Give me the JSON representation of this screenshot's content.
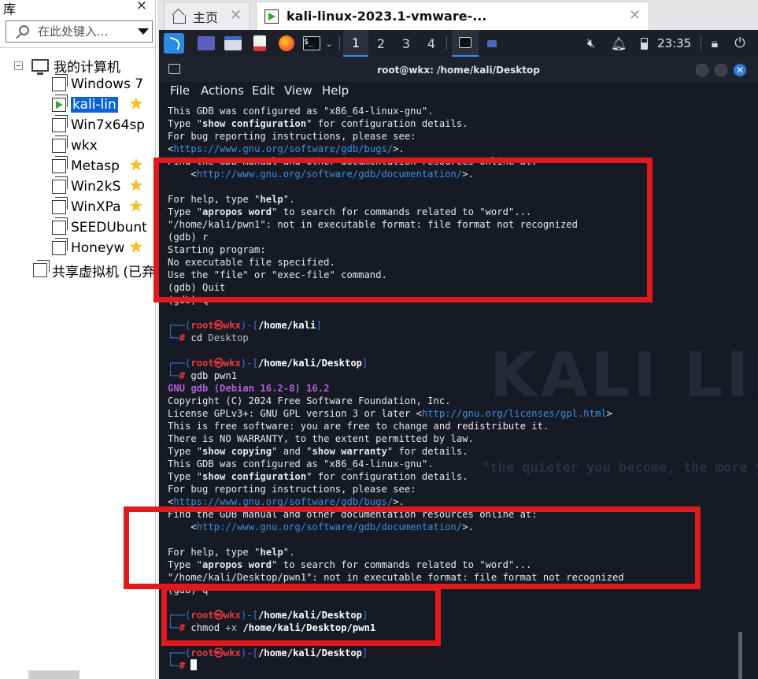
{
  "library": {
    "title": "库",
    "close": "×",
    "search_placeholder": "在此处键入...",
    "root": "我的计算机",
    "items": [
      {
        "label": "Windows 7",
        "starred": false,
        "running": false,
        "selected": false
      },
      {
        "label": "kali-lin",
        "starred": true,
        "running": true,
        "selected": true
      },
      {
        "label": "Win7x64sp",
        "starred": false,
        "running": false,
        "selected": false
      },
      {
        "label": "wkx",
        "starred": false,
        "running": false,
        "selected": false
      },
      {
        "label": "Metasp",
        "starred": true,
        "running": false,
        "selected": false
      },
      {
        "label": "Win2kS",
        "starred": true,
        "running": false,
        "selected": false
      },
      {
        "label": "WinXPa",
        "starred": true,
        "running": false,
        "selected": false
      },
      {
        "label": "SEEDUbunt",
        "starred": false,
        "running": false,
        "selected": false
      },
      {
        "label": "Honeyw",
        "starred": true,
        "running": false,
        "selected": false
      }
    ],
    "shared": "共享虚拟机 (已弃"
  },
  "tabs": {
    "home": "主页",
    "vm": "kali-linux-2023.1-vmware-..."
  },
  "kali_panel": {
    "workspaces": [
      "1",
      "2",
      "3",
      "4"
    ],
    "active_workspace": "1",
    "clock": "23:35"
  },
  "terminal": {
    "title": "root@wkx: /home/kali/Desktop",
    "menu": [
      "File",
      "Actions",
      "Edit",
      "View",
      "Help"
    ],
    "watermark_logo": "KALI LINUX",
    "watermark_slogan": "\"the quieter you become, the more you are able to hear\"",
    "lines": [
      [
        {
          "t": "This GDB was configured as \"x86_64-linux-gnu\"."
        }
      ],
      [
        {
          "t": "Type \""
        },
        {
          "t": "show configuration",
          "c": "b"
        },
        {
          "t": "\" for configuration details."
        }
      ],
      [
        {
          "t": "For bug reporting instructions, please see:"
        }
      ],
      [
        {
          "t": "<"
        },
        {
          "t": "https://www.gnu.org/software/gdb/bugs/",
          "c": "cyan"
        },
        {
          "t": ">."
        }
      ],
      [
        {
          "t": "Find the GDB manual and other documentation resources online at:"
        }
      ],
      [
        {
          "t": "    <"
        },
        {
          "t": "http://www.gnu.org/software/gdb/documentation/",
          "c": "cyan"
        },
        {
          "t": ">."
        }
      ],
      [],
      [
        {
          "t": "For help, type \""
        },
        {
          "t": "help",
          "c": "b"
        },
        {
          "t": "\"."
        }
      ],
      [
        {
          "t": "Type \""
        },
        {
          "t": "apropos word",
          "c": "b"
        },
        {
          "t": "\" to search for commands related to \"word\"..."
        }
      ],
      [
        {
          "t": "\"/home/kali/pwn1\": not in executable format: file format not recognized"
        }
      ],
      [
        {
          "t": "(gdb) r"
        }
      ],
      [
        {
          "t": "Starting program:"
        }
      ],
      [
        {
          "t": "No executable file specified."
        }
      ],
      [
        {
          "t": "Use the \"file\" or \"exec-file\" command."
        }
      ],
      [
        {
          "t": "(gdb) Quit"
        }
      ],
      [
        {
          "t": "(gdb) q"
        }
      ],
      [],
      [
        {
          "t": "┌──(",
          "c": "blue"
        },
        {
          "t": "root㉿wkx",
          "c": "red"
        },
        {
          "t": ")-[",
          "c": "blue"
        },
        {
          "t": "/home/kali",
          "c": "path"
        },
        {
          "t": "]",
          "c": "blue"
        }
      ],
      [
        {
          "t": "└─",
          "c": "blue"
        },
        {
          "t": "#",
          "c": "red"
        },
        {
          "t": " cd "
        },
        {
          "t": "Desktop",
          "c": "gray"
        }
      ],
      [],
      [
        {
          "t": "┌──(",
          "c": "blue"
        },
        {
          "t": "root㉿wkx",
          "c": "red"
        },
        {
          "t": ")-[",
          "c": "blue"
        },
        {
          "t": "/home/kali/Desktop",
          "c": "path"
        },
        {
          "t": "]",
          "c": "blue"
        }
      ],
      [
        {
          "t": "└─",
          "c": "blue"
        },
        {
          "t": "#",
          "c": "red"
        },
        {
          "t": " gdb "
        },
        {
          "t": "pwn1"
        }
      ],
      [
        {
          "t": "GNU gdb (Debian 16.2-8) 16.2",
          "c": "purple"
        }
      ],
      [
        {
          "t": "Copyright (C) 2024 Free Software Foundation, Inc."
        }
      ],
      [
        {
          "t": "License GPLv3+: GNU GPL version 3 or later <"
        },
        {
          "t": "http://gnu.org/licenses/gpl.html",
          "c": "cyan"
        },
        {
          "t": ">"
        }
      ],
      [
        {
          "t": "This is free software: you are free to change and redistribute it."
        }
      ],
      [
        {
          "t": "There is NO WARRANTY, to the extent permitted by law."
        }
      ],
      [
        {
          "t": "Type \""
        },
        {
          "t": "show copying",
          "c": "b"
        },
        {
          "t": "\" and \""
        },
        {
          "t": "show warranty",
          "c": "b"
        },
        {
          "t": "\" for details."
        }
      ],
      [
        {
          "t": "This GDB was configured as \"x86_64-linux-gnu\"."
        }
      ],
      [
        {
          "t": "Type \""
        },
        {
          "t": "show configuration",
          "c": "b"
        },
        {
          "t": "\" for configuration details."
        }
      ],
      [
        {
          "t": "For bug reporting instructions, please see:"
        }
      ],
      [
        {
          "t": "<"
        },
        {
          "t": "https://www.gnu.org/software/gdb/bugs/",
          "c": "cyan"
        },
        {
          "t": ">."
        }
      ],
      [
        {
          "t": "Find the GDB manual and other documentation resources online at:"
        }
      ],
      [
        {
          "t": "    <"
        },
        {
          "t": "http://www.gnu.org/software/gdb/documentation/",
          "c": "cyan"
        },
        {
          "t": ">."
        }
      ],
      [],
      [
        {
          "t": "For help, type \""
        },
        {
          "t": "help",
          "c": "b"
        },
        {
          "t": "\"."
        }
      ],
      [
        {
          "t": "Type \""
        },
        {
          "t": "apropos word",
          "c": "b"
        },
        {
          "t": "\" to search for commands related to \"word\"..."
        }
      ],
      [
        {
          "t": "\"/home/kali/Desktop/pwn1\": not in executable format: file format not recognized"
        }
      ],
      [
        {
          "t": "(gdb) q"
        }
      ],
      [],
      [
        {
          "t": "┌──(",
          "c": "blue"
        },
        {
          "t": "root㉿wkx",
          "c": "red"
        },
        {
          "t": ")-[",
          "c": "blue"
        },
        {
          "t": "/home/kali/Desktop",
          "c": "path"
        },
        {
          "t": "]",
          "c": "blue"
        }
      ],
      [
        {
          "t": "└─",
          "c": "blue"
        },
        {
          "t": "#",
          "c": "red"
        },
        {
          "t": " chmod "
        },
        {
          "t": "+x",
          "c": "cmd-flag"
        },
        {
          "t": " "
        },
        {
          "t": "/home/kali/Desktop/pwn1",
          "c": "path"
        }
      ],
      [],
      [
        {
          "t": "┌──(",
          "c": "blue"
        },
        {
          "t": "root㉿wkx",
          "c": "red"
        },
        {
          "t": ")-[",
          "c": "blue"
        },
        {
          "t": "/home/kali/Desktop",
          "c": "path"
        },
        {
          "t": "]",
          "c": "blue"
        }
      ],
      [
        {
          "t": "└─",
          "c": "blue"
        },
        {
          "t": "#",
          "c": "red"
        },
        {
          "t": " "
        },
        {
          "t": "",
          "c": "cursor"
        }
      ]
    ]
  },
  "colors": {
    "annotation_red": "#e0191d",
    "terminal_bg": "#161a25",
    "selection_blue": "#0a64d8"
  }
}
